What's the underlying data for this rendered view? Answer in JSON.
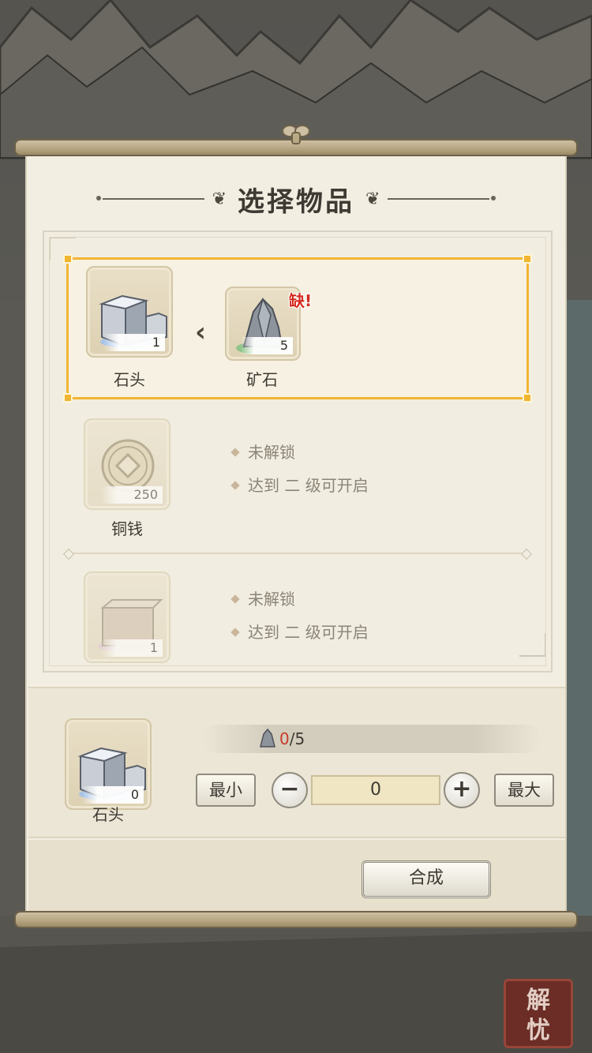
{
  "dialog": {
    "title": "选择物品"
  },
  "recipes": [
    {
      "state": "selected",
      "output": {
        "name": "石头",
        "count": "1",
        "icon": "stone-block-icon"
      },
      "ingredient": {
        "name": "矿石",
        "count": "5",
        "icon": "ore-icon",
        "badge": "缺!"
      }
    },
    {
      "state": "locked",
      "output": {
        "name": "铜钱",
        "count": "250",
        "icon": "copper-coin-icon"
      },
      "lock_lines": [
        "未解锁",
        "达到 二 级可开启"
      ]
    },
    {
      "state": "locked",
      "output": {
        "name": "",
        "count": "1",
        "icon": "clay-block-icon"
      },
      "lock_lines": [
        "未解锁",
        "达到 二 级可开启"
      ]
    }
  ],
  "craft": {
    "item_name": "石头",
    "item_count": "0",
    "item_icon": "stone-block-icon",
    "requirement_icon": "ore-icon",
    "requirement_have": "0",
    "requirement_need": "/5",
    "min_label": "最小",
    "max_label": "最大",
    "minus_symbol": "−",
    "plus_symbol": "+",
    "quantity": "0",
    "craft_label": "合成"
  },
  "corner_seal": {
    "line1": "解",
    "line2": "忧"
  },
  "colors": {
    "selected_border": "#f2b532",
    "lack_badge": "#d42a1f",
    "insufficient_count": "#c83a2c",
    "paper": "#f2eee2"
  }
}
